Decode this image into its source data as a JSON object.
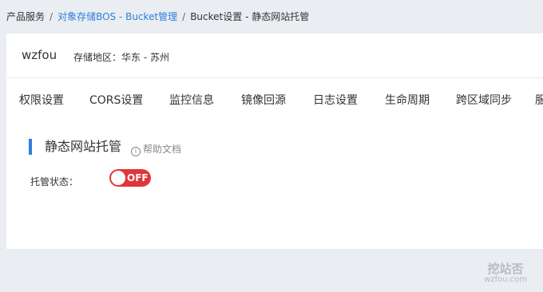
{
  "breadcrumb": {
    "item1": "产品服务",
    "sep": "/",
    "item2": "对象存储BOS - Bucket管理",
    "item3": "Bucket设置 - 静态网站托管"
  },
  "bucket": {
    "name": "wzfou",
    "region": "存储地区：华东 - 苏州"
  },
  "tabs": [
    "权限设置",
    "CORS设置",
    "监控信息",
    "镜像回源",
    "日志设置",
    "生命周期",
    "跨区域同步",
    "服"
  ],
  "section": {
    "title": "静态网站托管",
    "help_icon": "i",
    "help_label": "帮助文档"
  },
  "hosting": {
    "status_label": "托管状态：",
    "toggle_text": "OFF",
    "enabled": false
  },
  "watermark": {
    "title": "挖站否",
    "subtitle": "wzfou.com"
  },
  "colors": {
    "accent": "#2d7fdc",
    "toggle_off": "#e0363a",
    "background": "#eaedf1"
  }
}
